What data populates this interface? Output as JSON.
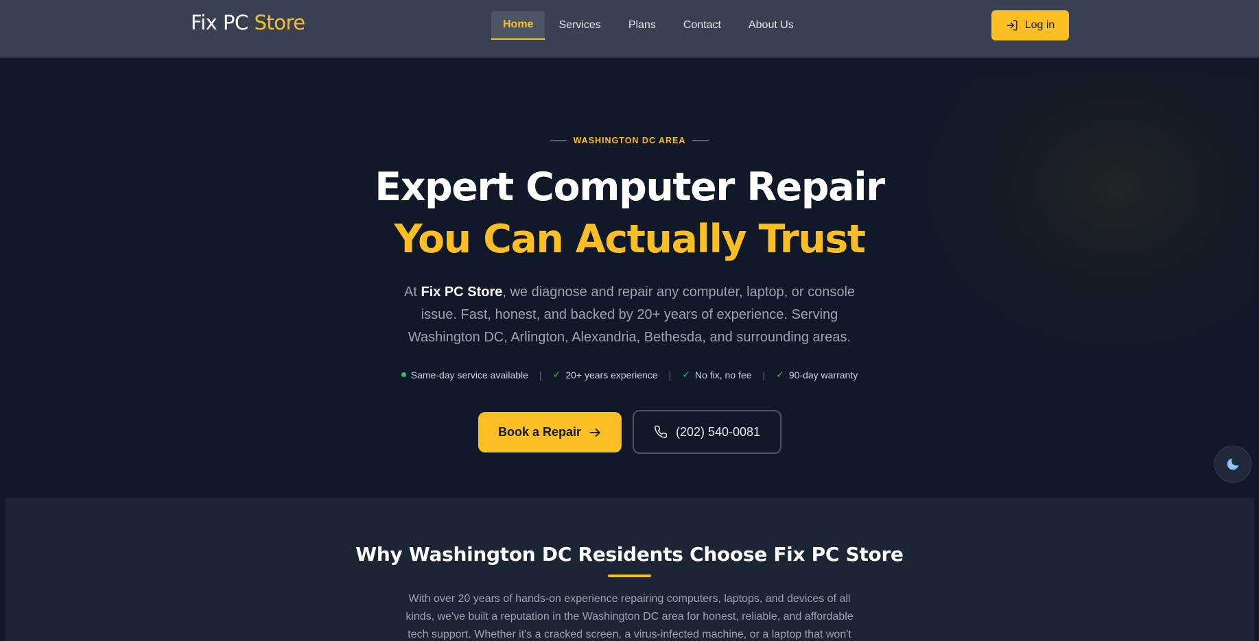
{
  "header": {
    "logo_part1": "Fix PC",
    "logo_part2": "Store",
    "nav": [
      "Home",
      "Services",
      "Plans",
      "Contact",
      "About Us"
    ],
    "active_nav": "Home",
    "login_label": "Log in"
  },
  "hero": {
    "eyebrow": "WASHINGTON DC AREA",
    "title_line1": "Expert Computer Repair",
    "title_line2": "You Can Actually Trust",
    "lead_prefix": "At ",
    "lead_brand": "Fix PC Store",
    "lead_rest": ", we diagnose and repair any computer, laptop, or console issue. Fast, honest, and backed by 20+ years of experience. Serving Washington DC, Arlington, Alexandria, Bethesda, and surrounding areas.",
    "features": [
      "Same-day service available",
      "20+ years experience",
      "No fix, no fee",
      "90-day warranty"
    ],
    "book_label": "Book a Repair",
    "phone": "(202) 540-0081"
  },
  "why": {
    "title": "Why Washington DC Residents Choose Fix PC Store",
    "text": "With over 20 years of hands-on experience repairing computers, laptops, and devices of all kinds, we've built a reputation in the Washington DC area for honest, reliable, and affordable tech support. Whether it's a cracked screen, a virus-infected machine, or a laptop that won't"
  },
  "colors": {
    "accent": "#fbbf24",
    "background": "#111827",
    "header": "#374151",
    "success": "#22c55e"
  },
  "icons": [
    "login-icon",
    "arrow-right-icon",
    "phone-icon",
    "moon-icon",
    "check-icon"
  ]
}
